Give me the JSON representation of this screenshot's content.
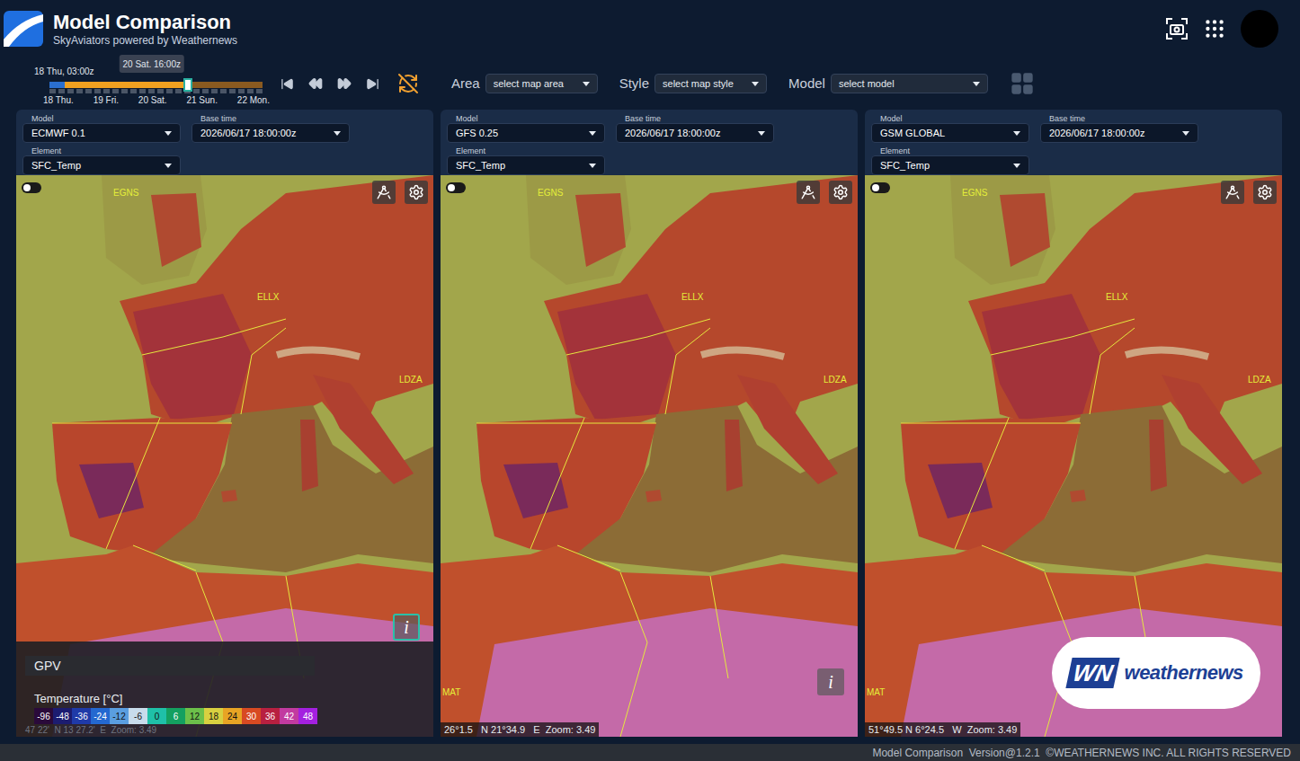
{
  "header": {
    "title": "Model Comparison",
    "subtitle": "SkyAviators powered by Weathernews"
  },
  "timeline": {
    "start_label": "18 Thu, 03:00z",
    "current": "20 Sat. 16:00z",
    "days": [
      "18 Thu.",
      "19 Fri.",
      "20 Sat.",
      "21 Sun.",
      "22 Mon."
    ],
    "level": 0.65,
    "past_level": 0.07
  },
  "toolbar": {
    "selects": [
      {
        "label": "Area",
        "value": "select map area"
      },
      {
        "label": "Style",
        "value": "select map style"
      },
      {
        "label": "Model",
        "value": "select model"
      }
    ]
  },
  "field_labels": {
    "model": "Model",
    "base_time": "Base time",
    "element": "Element"
  },
  "panels": [
    {
      "model": "ECMWF 0.1",
      "base_time": "2026/06/17 18:00:00z",
      "element": "SFC_Temp",
      "airports": [
        "EGNS",
        "ELLX",
        "LDZA"
      ],
      "toggle_on": false,
      "info": {
        "label": "i",
        "active": true
      },
      "coords": "47 22'  N 13 27.2'  E  Zoom: 3.49",
      "legend": {
        "title": "GPV",
        "unit": "Temperature [°C]",
        "scale": [
          {
            "label": "-96",
            "color": "#2a0a3a"
          },
          {
            "label": "-48",
            "color": "#1c1c70"
          },
          {
            "label": "-36",
            "color": "#1f3aa8"
          },
          {
            "label": "-24",
            "color": "#2468d0"
          },
          {
            "label": "-12",
            "color": "#5a9ee0"
          },
          {
            "label": "-6",
            "color": "#c8dcec"
          },
          {
            "label": "0",
            "color": "#1fc0a8"
          },
          {
            "label": "6",
            "color": "#14a060"
          },
          {
            "label": "12",
            "color": "#6cc04a"
          },
          {
            "label": "18",
            "color": "#d8d040"
          },
          {
            "label": "24",
            "color": "#e8a424"
          },
          {
            "label": "30",
            "color": "#d84a22"
          },
          {
            "label": "36",
            "color": "#b82040"
          },
          {
            "label": "42",
            "color": "#c23aa0"
          },
          {
            "label": "48",
            "color": "#a420e0"
          }
        ]
      },
      "logo": null
    },
    {
      "model": "GFS 0.25",
      "base_time": "2026/06/17 18:00:00z",
      "element": "SFC_Temp",
      "airports": [
        "EGNS",
        "ELLX",
        "LDZA",
        "MAT"
      ],
      "toggle_on": false,
      "info": {
        "label": "i",
        "active": false
      },
      "coords": "26°1.5   N 21°34.9   E  Zoom: 3.49",
      "legend": null,
      "logo": null
    },
    {
      "model": "GSM GLOBAL",
      "base_time": "2026/06/17 18:00:00z",
      "element": "SFC_Temp",
      "airports": [
        "EGNS",
        "ELLX",
        "LDZA",
        "MAT"
      ],
      "toggle_on": false,
      "info": null,
      "coords": "51°49.5 N 6°24.5   W  Zoom: 3.49",
      "legend": null,
      "logo": {
        "mark": "WN",
        "text": "weathernews"
      }
    }
  ],
  "footer": "Model Comparison  Version@1.2.1  ©WEATHERNEWS INC. ALL RIGHTS RESERVED"
}
